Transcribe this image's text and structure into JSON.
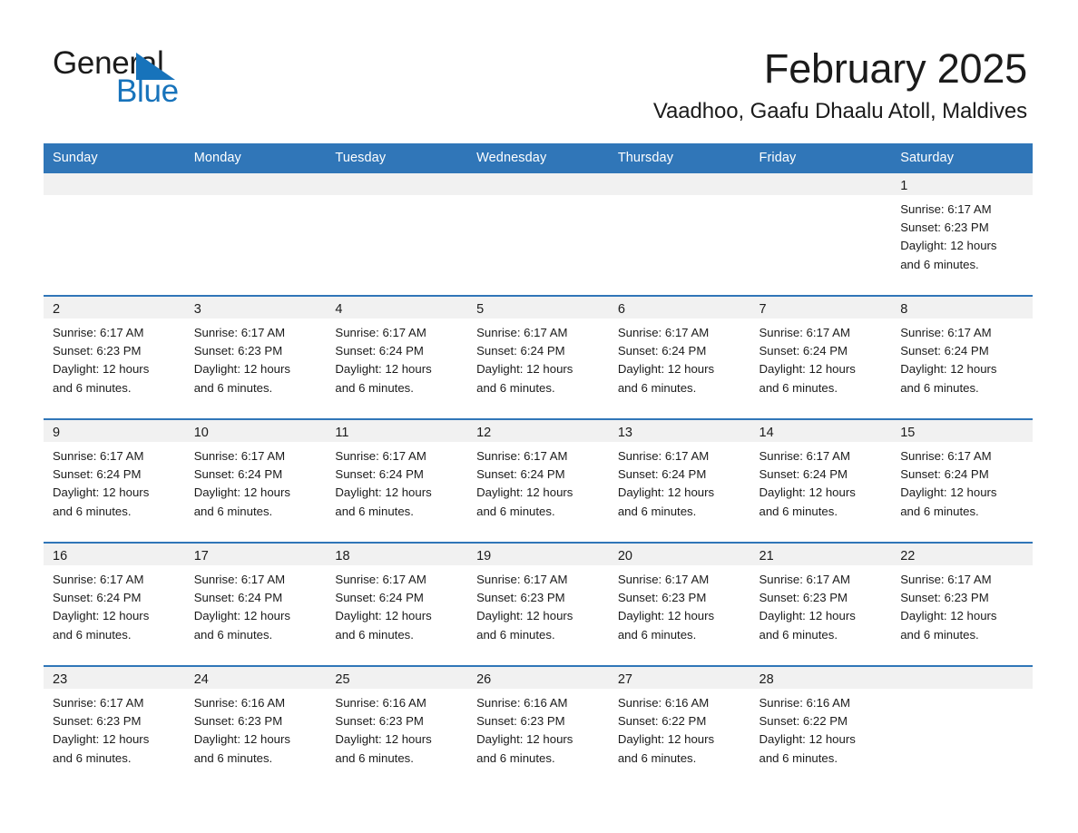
{
  "brand": {
    "name_part1": "General",
    "name_part2": "Blue",
    "accent_color": "#1773bb"
  },
  "header": {
    "month_title": "February 2025",
    "location": "Vaadhoo, Gaafu Dhaalu Atoll, Maldives"
  },
  "theme": {
    "header_bg": "#3076b8",
    "row_divider": "#3076b8",
    "daynum_band_bg": "#f1f1f1",
    "text_color": "#1b1b1b"
  },
  "weekday_headers": [
    "Sunday",
    "Monday",
    "Tuesday",
    "Wednesday",
    "Thursday",
    "Friday",
    "Saturday"
  ],
  "weeks": [
    [
      {
        "day": "",
        "sunrise": "",
        "sunset": "",
        "daylight_line1": "",
        "daylight_line2": "",
        "empty": true
      },
      {
        "day": "",
        "sunrise": "",
        "sunset": "",
        "daylight_line1": "",
        "daylight_line2": "",
        "empty": true
      },
      {
        "day": "",
        "sunrise": "",
        "sunset": "",
        "daylight_line1": "",
        "daylight_line2": "",
        "empty": true
      },
      {
        "day": "",
        "sunrise": "",
        "sunset": "",
        "daylight_line1": "",
        "daylight_line2": "",
        "empty": true
      },
      {
        "day": "",
        "sunrise": "",
        "sunset": "",
        "daylight_line1": "",
        "daylight_line2": "",
        "empty": true
      },
      {
        "day": "",
        "sunrise": "",
        "sunset": "",
        "daylight_line1": "",
        "daylight_line2": "",
        "empty": true
      },
      {
        "day": "1",
        "sunrise": "Sunrise: 6:17 AM",
        "sunset": "Sunset: 6:23 PM",
        "daylight_line1": "Daylight: 12 hours",
        "daylight_line2": "and 6 minutes.",
        "empty": false
      }
    ],
    [
      {
        "day": "2",
        "sunrise": "Sunrise: 6:17 AM",
        "sunset": "Sunset: 6:23 PM",
        "daylight_line1": "Daylight: 12 hours",
        "daylight_line2": "and 6 minutes.",
        "empty": false
      },
      {
        "day": "3",
        "sunrise": "Sunrise: 6:17 AM",
        "sunset": "Sunset: 6:23 PM",
        "daylight_line1": "Daylight: 12 hours",
        "daylight_line2": "and 6 minutes.",
        "empty": false
      },
      {
        "day": "4",
        "sunrise": "Sunrise: 6:17 AM",
        "sunset": "Sunset: 6:24 PM",
        "daylight_line1": "Daylight: 12 hours",
        "daylight_line2": "and 6 minutes.",
        "empty": false
      },
      {
        "day": "5",
        "sunrise": "Sunrise: 6:17 AM",
        "sunset": "Sunset: 6:24 PM",
        "daylight_line1": "Daylight: 12 hours",
        "daylight_line2": "and 6 minutes.",
        "empty": false
      },
      {
        "day": "6",
        "sunrise": "Sunrise: 6:17 AM",
        "sunset": "Sunset: 6:24 PM",
        "daylight_line1": "Daylight: 12 hours",
        "daylight_line2": "and 6 minutes.",
        "empty": false
      },
      {
        "day": "7",
        "sunrise": "Sunrise: 6:17 AM",
        "sunset": "Sunset: 6:24 PM",
        "daylight_line1": "Daylight: 12 hours",
        "daylight_line2": "and 6 minutes.",
        "empty": false
      },
      {
        "day": "8",
        "sunrise": "Sunrise: 6:17 AM",
        "sunset": "Sunset: 6:24 PM",
        "daylight_line1": "Daylight: 12 hours",
        "daylight_line2": "and 6 minutes.",
        "empty": false
      }
    ],
    [
      {
        "day": "9",
        "sunrise": "Sunrise: 6:17 AM",
        "sunset": "Sunset: 6:24 PM",
        "daylight_line1": "Daylight: 12 hours",
        "daylight_line2": "and 6 minutes.",
        "empty": false
      },
      {
        "day": "10",
        "sunrise": "Sunrise: 6:17 AM",
        "sunset": "Sunset: 6:24 PM",
        "daylight_line1": "Daylight: 12 hours",
        "daylight_line2": "and 6 minutes.",
        "empty": false
      },
      {
        "day": "11",
        "sunrise": "Sunrise: 6:17 AM",
        "sunset": "Sunset: 6:24 PM",
        "daylight_line1": "Daylight: 12 hours",
        "daylight_line2": "and 6 minutes.",
        "empty": false
      },
      {
        "day": "12",
        "sunrise": "Sunrise: 6:17 AM",
        "sunset": "Sunset: 6:24 PM",
        "daylight_line1": "Daylight: 12 hours",
        "daylight_line2": "and 6 minutes.",
        "empty": false
      },
      {
        "day": "13",
        "sunrise": "Sunrise: 6:17 AM",
        "sunset": "Sunset: 6:24 PM",
        "daylight_line1": "Daylight: 12 hours",
        "daylight_line2": "and 6 minutes.",
        "empty": false
      },
      {
        "day": "14",
        "sunrise": "Sunrise: 6:17 AM",
        "sunset": "Sunset: 6:24 PM",
        "daylight_line1": "Daylight: 12 hours",
        "daylight_line2": "and 6 minutes.",
        "empty": false
      },
      {
        "day": "15",
        "sunrise": "Sunrise: 6:17 AM",
        "sunset": "Sunset: 6:24 PM",
        "daylight_line1": "Daylight: 12 hours",
        "daylight_line2": "and 6 minutes.",
        "empty": false
      }
    ],
    [
      {
        "day": "16",
        "sunrise": "Sunrise: 6:17 AM",
        "sunset": "Sunset: 6:24 PM",
        "daylight_line1": "Daylight: 12 hours",
        "daylight_line2": "and 6 minutes.",
        "empty": false
      },
      {
        "day": "17",
        "sunrise": "Sunrise: 6:17 AM",
        "sunset": "Sunset: 6:24 PM",
        "daylight_line1": "Daylight: 12 hours",
        "daylight_line2": "and 6 minutes.",
        "empty": false
      },
      {
        "day": "18",
        "sunrise": "Sunrise: 6:17 AM",
        "sunset": "Sunset: 6:24 PM",
        "daylight_line1": "Daylight: 12 hours",
        "daylight_line2": "and 6 minutes.",
        "empty": false
      },
      {
        "day": "19",
        "sunrise": "Sunrise: 6:17 AM",
        "sunset": "Sunset: 6:23 PM",
        "daylight_line1": "Daylight: 12 hours",
        "daylight_line2": "and 6 minutes.",
        "empty": false
      },
      {
        "day": "20",
        "sunrise": "Sunrise: 6:17 AM",
        "sunset": "Sunset: 6:23 PM",
        "daylight_line1": "Daylight: 12 hours",
        "daylight_line2": "and 6 minutes.",
        "empty": false
      },
      {
        "day": "21",
        "sunrise": "Sunrise: 6:17 AM",
        "sunset": "Sunset: 6:23 PM",
        "daylight_line1": "Daylight: 12 hours",
        "daylight_line2": "and 6 minutes.",
        "empty": false
      },
      {
        "day": "22",
        "sunrise": "Sunrise: 6:17 AM",
        "sunset": "Sunset: 6:23 PM",
        "daylight_line1": "Daylight: 12 hours",
        "daylight_line2": "and 6 minutes.",
        "empty": false
      }
    ],
    [
      {
        "day": "23",
        "sunrise": "Sunrise: 6:17 AM",
        "sunset": "Sunset: 6:23 PM",
        "daylight_line1": "Daylight: 12 hours",
        "daylight_line2": "and 6 minutes.",
        "empty": false
      },
      {
        "day": "24",
        "sunrise": "Sunrise: 6:16 AM",
        "sunset": "Sunset: 6:23 PM",
        "daylight_line1": "Daylight: 12 hours",
        "daylight_line2": "and 6 minutes.",
        "empty": false
      },
      {
        "day": "25",
        "sunrise": "Sunrise: 6:16 AM",
        "sunset": "Sunset: 6:23 PM",
        "daylight_line1": "Daylight: 12 hours",
        "daylight_line2": "and 6 minutes.",
        "empty": false
      },
      {
        "day": "26",
        "sunrise": "Sunrise: 6:16 AM",
        "sunset": "Sunset: 6:23 PM",
        "daylight_line1": "Daylight: 12 hours",
        "daylight_line2": "and 6 minutes.",
        "empty": false
      },
      {
        "day": "27",
        "sunrise": "Sunrise: 6:16 AM",
        "sunset": "Sunset: 6:22 PM",
        "daylight_line1": "Daylight: 12 hours",
        "daylight_line2": "and 6 minutes.",
        "empty": false
      },
      {
        "day": "28",
        "sunrise": "Sunrise: 6:16 AM",
        "sunset": "Sunset: 6:22 PM",
        "daylight_line1": "Daylight: 12 hours",
        "daylight_line2": "and 6 minutes.",
        "empty": false
      },
      {
        "day": "",
        "sunrise": "",
        "sunset": "",
        "daylight_line1": "",
        "daylight_line2": "",
        "empty": true
      }
    ]
  ]
}
